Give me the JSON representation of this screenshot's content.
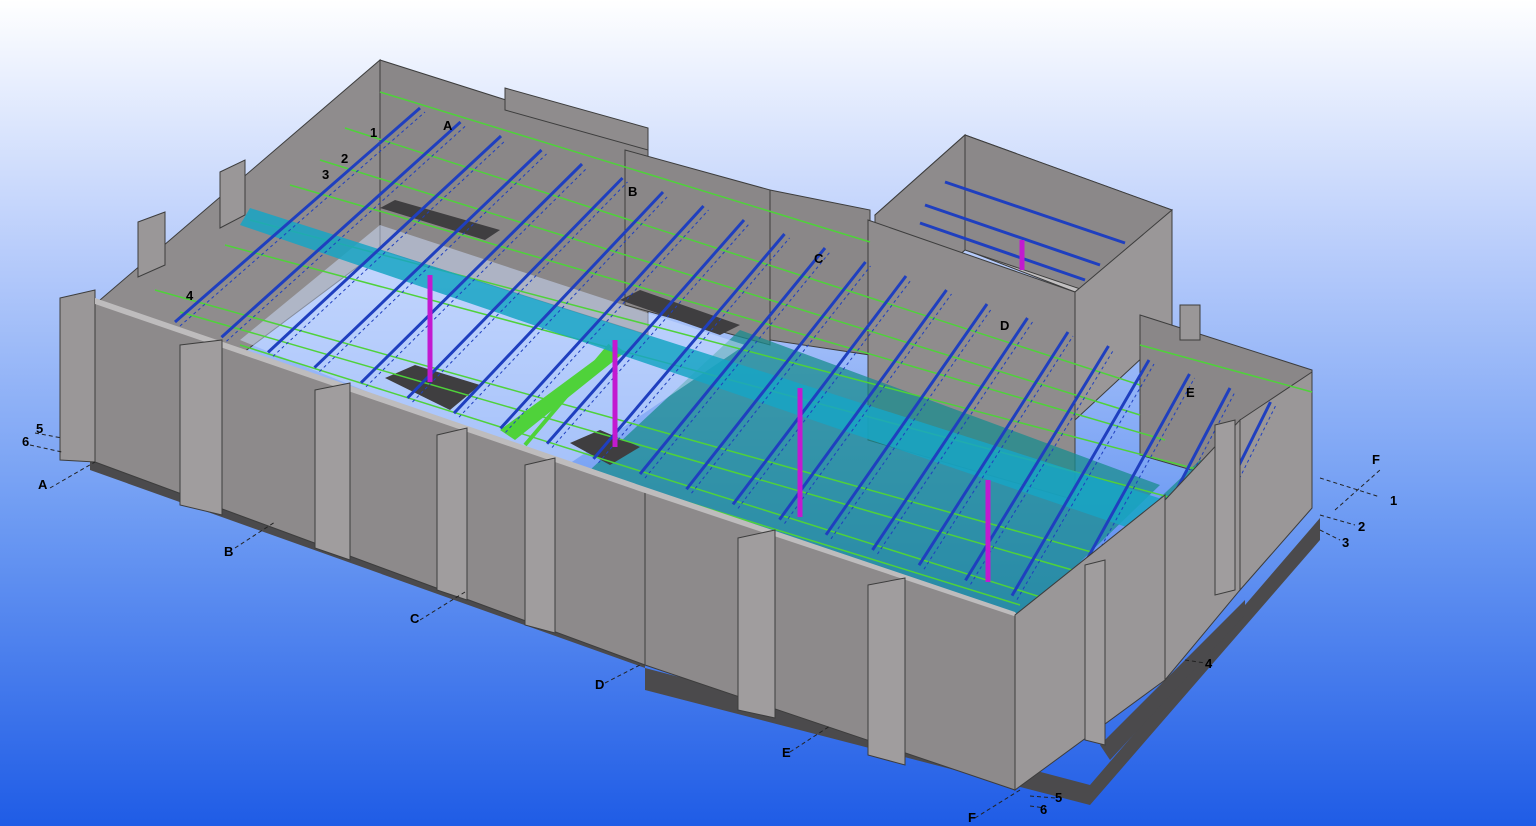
{
  "viewport": {
    "background_top": "#ffffff",
    "background_bottom": "#1f5ce6"
  },
  "colors": {
    "wall_face": "#8e8b8c",
    "wall_top": "#b8b6b7",
    "wall_edge": "#4a4a4a",
    "truss": "#1f3fbf",
    "secondary_beam": "#4fd23a",
    "main_beam": "#18a5c4",
    "column": "#c21ad0",
    "slab": "#1a8c8f",
    "foundation": "#4b4a4c"
  },
  "grid_axes": {
    "lettered_near": [
      "A",
      "B",
      "C",
      "D",
      "E",
      "F"
    ],
    "lettered_roof": [
      "A",
      "B",
      "C",
      "D",
      "E"
    ],
    "numbered_left": [
      "5",
      "6"
    ],
    "numbered_right": [
      "1",
      "2",
      "3",
      "4"
    ],
    "numbered_bottom": [
      "5",
      "6"
    ],
    "numbered_roof": [
      "1",
      "2",
      "3",
      "4"
    ],
    "right_letter": "F"
  }
}
